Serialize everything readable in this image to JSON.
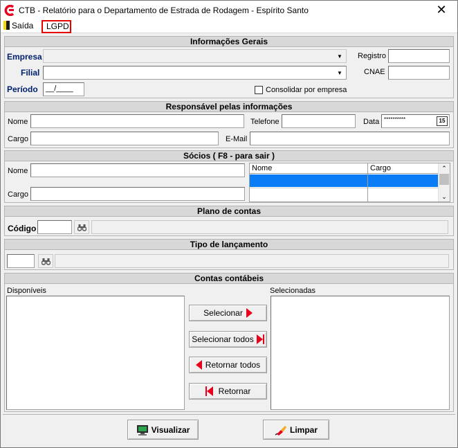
{
  "window": {
    "title": "CTB - Relatório para o Departamento de Estrada de Rodagem - Espírito Santo",
    "close_glyph": "✕"
  },
  "menu": {
    "exit_label": "Saída",
    "lgpd_label": "LGPD",
    "highlight_color": "#e60000"
  },
  "general": {
    "header": "Informações Gerais",
    "empresa_label": "Empresa",
    "filial_label": "Filial",
    "periodo_label": "Período",
    "periodo_value": "__/____",
    "registro_label": "Registro",
    "cnae_label": "CNAE",
    "consolidar_label": "Consolidar por empresa"
  },
  "responsible": {
    "header": "Responsável pelas informações",
    "nome_label": "Nome",
    "telefone_label": "Telefone",
    "data_label": "Data",
    "data_value": "**********",
    "cal_label": "15",
    "cargo_label": "Cargo",
    "email_label": "E-Mail"
  },
  "partners": {
    "header": "Sócios ( F8 - para sair )",
    "nome_label": "Nome",
    "cargo_label": "Cargo",
    "grid_columns": [
      "Nome",
      "Cargo"
    ],
    "selection_color": "#0a7cf5"
  },
  "accounts_plan": {
    "header": "Plano de contas",
    "codigo_label": "Código"
  },
  "entry_type": {
    "header": "Tipo de lançamento"
  },
  "accounts": {
    "header": "Contas contábeis",
    "available_label": "Disponíveis",
    "selected_label": "Selecionadas",
    "select_btn": "Selecionar",
    "select_all_btn": "Selecionar todos",
    "return_all_btn": "Retornar todos",
    "return_btn": "Retornar",
    "arrow_color": "#e8001c"
  },
  "footer": {
    "view_btn": "Visualizar",
    "clear_btn": "Limpar"
  }
}
